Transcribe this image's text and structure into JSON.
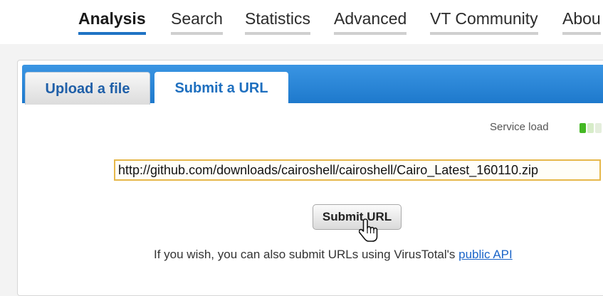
{
  "nav": {
    "items": [
      {
        "label": "Analysis",
        "active": true
      },
      {
        "label": "Search",
        "active": false
      },
      {
        "label": "Statistics",
        "active": false
      },
      {
        "label": "Advanced",
        "active": false
      },
      {
        "label": "VT Community",
        "active": false
      },
      {
        "label": "Abou",
        "active": false
      }
    ]
  },
  "tabs": [
    {
      "label": "Upload a file",
      "active": false
    },
    {
      "label": "Submit a URL",
      "active": true
    }
  ],
  "service_load": {
    "label": "Service load",
    "colors": [
      "#44b824",
      "#d6ecc8",
      "#e4eedc"
    ]
  },
  "url_input": {
    "value": "http://github.com/downloads/cairoshell/cairoshell/Cairo_Latest_160110.zip"
  },
  "submit_button": {
    "label": "Submit URL"
  },
  "api_note": {
    "text": "If you wish, you can also submit URLs using VirusTotal's ",
    "link_label": "public API"
  },
  "colors": {
    "accent": "#1f73c4",
    "tab_bar": "#2a88d8",
    "input_border": "#e6b84a"
  },
  "icons": {
    "cursor": "hand-pointer-icon"
  }
}
